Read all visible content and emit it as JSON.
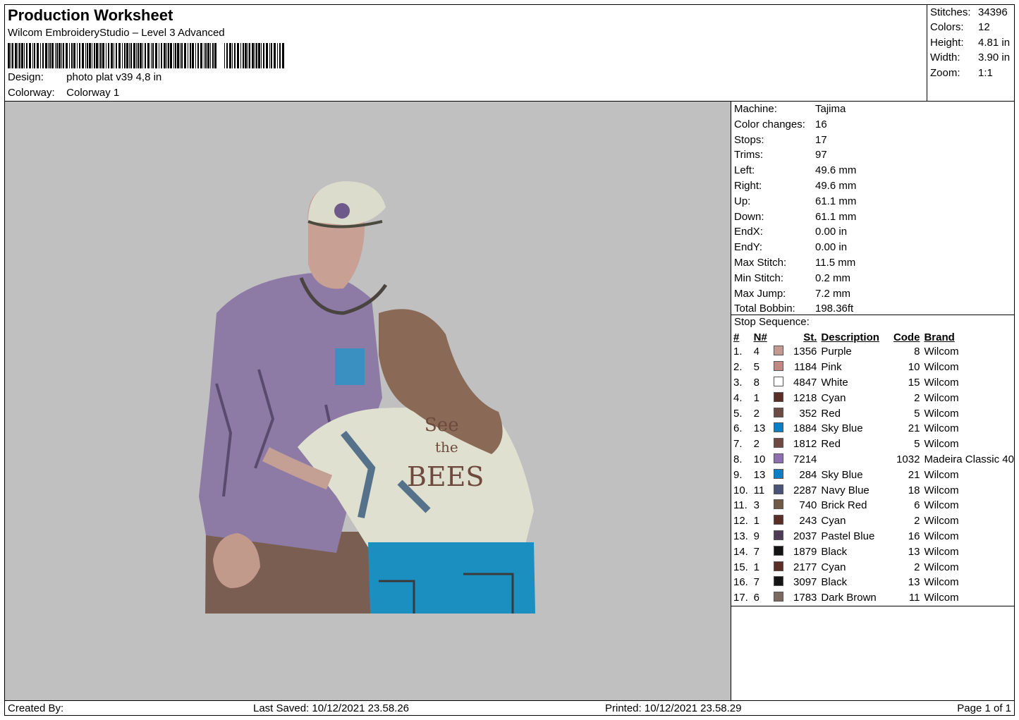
{
  "header": {
    "title": "Production Worksheet",
    "software": "Wilcom EmbroideryStudio – Level 3 Advanced",
    "design_label": "Design:",
    "design_value": "photo plat v39 4,8 in",
    "colorway_label": "Colorway:",
    "colorway_value": "Colorway 1"
  },
  "summary": {
    "stitches_label": "Stitches:",
    "stitches": "34396",
    "colors_label": "Colors:",
    "colors": "12",
    "height_label": "Height:",
    "height": "4.81 in",
    "width_label": "Width:",
    "width": "3.90 in",
    "zoom_label": "Zoom:",
    "zoom": "1:1"
  },
  "machine_info": [
    {
      "label": "Machine:",
      "value": "Tajima"
    },
    {
      "label": "Color changes:",
      "value": "16"
    },
    {
      "label": "Stops:",
      "value": "17"
    },
    {
      "label": "Trims:",
      "value": "97"
    },
    {
      "label": "Left:",
      "value": "49.6 mm"
    },
    {
      "label": "Right:",
      "value": "49.6 mm"
    },
    {
      "label": "Up:",
      "value": "61.1 mm"
    },
    {
      "label": "Down:",
      "value": "61.1 mm"
    },
    {
      "label": "EndX:",
      "value": "0.00 in"
    },
    {
      "label": "EndY:",
      "value": "0.00 in"
    },
    {
      "label": "Max Stitch:",
      "value": "11.5 mm"
    },
    {
      "label": "Min Stitch:",
      "value": "0.2 mm"
    },
    {
      "label": "Max Jump:",
      "value": "7.2 mm"
    },
    {
      "label": "Total Bobbin:",
      "value": "198.36ft"
    }
  ],
  "stop_sequence": {
    "title": "Stop Sequence:",
    "columns": {
      "idx": "#",
      "n": "N#",
      "st": "St.",
      "desc": "Description",
      "code": "Code",
      "brand": "Brand"
    },
    "rows": [
      {
        "idx": "1.",
        "n": "4",
        "color": "#c49a92",
        "st": "1356",
        "desc": "Purple",
        "code": "8",
        "brand": "Wilcom"
      },
      {
        "idx": "2.",
        "n": "5",
        "color": "#c28882",
        "st": "1184",
        "desc": "Pink",
        "code": "10",
        "brand": "Wilcom"
      },
      {
        "idx": "3.",
        "n": "8",
        "color": "#ffffff",
        "st": "4847",
        "desc": "White",
        "code": "15",
        "brand": "Wilcom"
      },
      {
        "idx": "4.",
        "n": "1",
        "color": "#5a2e26",
        "st": "1218",
        "desc": "Cyan",
        "code": "2",
        "brand": "Wilcom"
      },
      {
        "idx": "5.",
        "n": "2",
        "color": "#6e4a44",
        "st": "352",
        "desc": "Red",
        "code": "5",
        "brand": "Wilcom"
      },
      {
        "idx": "6.",
        "n": "13",
        "color": "#0a7fc4",
        "st": "1884",
        "desc": "Sky Blue",
        "code": "21",
        "brand": "Wilcom"
      },
      {
        "idx": "7.",
        "n": "2",
        "color": "#6e4a44",
        "st": "1812",
        "desc": "Red",
        "code": "5",
        "brand": "Wilcom"
      },
      {
        "idx": "8.",
        "n": "10",
        "color": "#8e70b0",
        "st": "7214",
        "desc": "",
        "code": "1032",
        "brand": "Madeira Classic 40"
      },
      {
        "idx": "9.",
        "n": "13",
        "color": "#0a7fc4",
        "st": "284",
        "desc": "Sky Blue",
        "code": "21",
        "brand": "Wilcom"
      },
      {
        "idx": "10.",
        "n": "11",
        "color": "#4a5478",
        "st": "2287",
        "desc": "Navy Blue",
        "code": "18",
        "brand": "Wilcom"
      },
      {
        "idx": "11.",
        "n": "3",
        "color": "#6e5a46",
        "st": "740",
        "desc": "Brick Red",
        "code": "6",
        "brand": "Wilcom"
      },
      {
        "idx": "12.",
        "n": "1",
        "color": "#5a2e26",
        "st": "243",
        "desc": "Cyan",
        "code": "2",
        "brand": "Wilcom"
      },
      {
        "idx": "13.",
        "n": "9",
        "color": "#4e3c54",
        "st": "2037",
        "desc": "Pastel Blue",
        "code": "16",
        "brand": "Wilcom"
      },
      {
        "idx": "14.",
        "n": "7",
        "color": "#141414",
        "st": "1879",
        "desc": "Black",
        "code": "13",
        "brand": "Wilcom"
      },
      {
        "idx": "15.",
        "n": "1",
        "color": "#5a2e26",
        "st": "2177",
        "desc": "Cyan",
        "code": "2",
        "brand": "Wilcom"
      },
      {
        "idx": "16.",
        "n": "7",
        "color": "#141414",
        "st": "3097",
        "desc": "Black",
        "code": "13",
        "brand": "Wilcom"
      },
      {
        "idx": "17.",
        "n": "6",
        "color": "#7a6a62",
        "st": "1783",
        "desc": "Dark Brown",
        "code": "11",
        "brand": "Wilcom"
      }
    ]
  },
  "design_image": {
    "cap_text": "",
    "jacket_text_line1": "See",
    "jacket_text_line2": "the",
    "jacket_text_line3": "BEES"
  },
  "footer": {
    "created_by": "Created By:",
    "last_saved": "Last Saved: 10/12/2021 23.58.26",
    "printed": "Printed: 10/12/2021 23.58.29",
    "page": "Page 1 of 1"
  }
}
